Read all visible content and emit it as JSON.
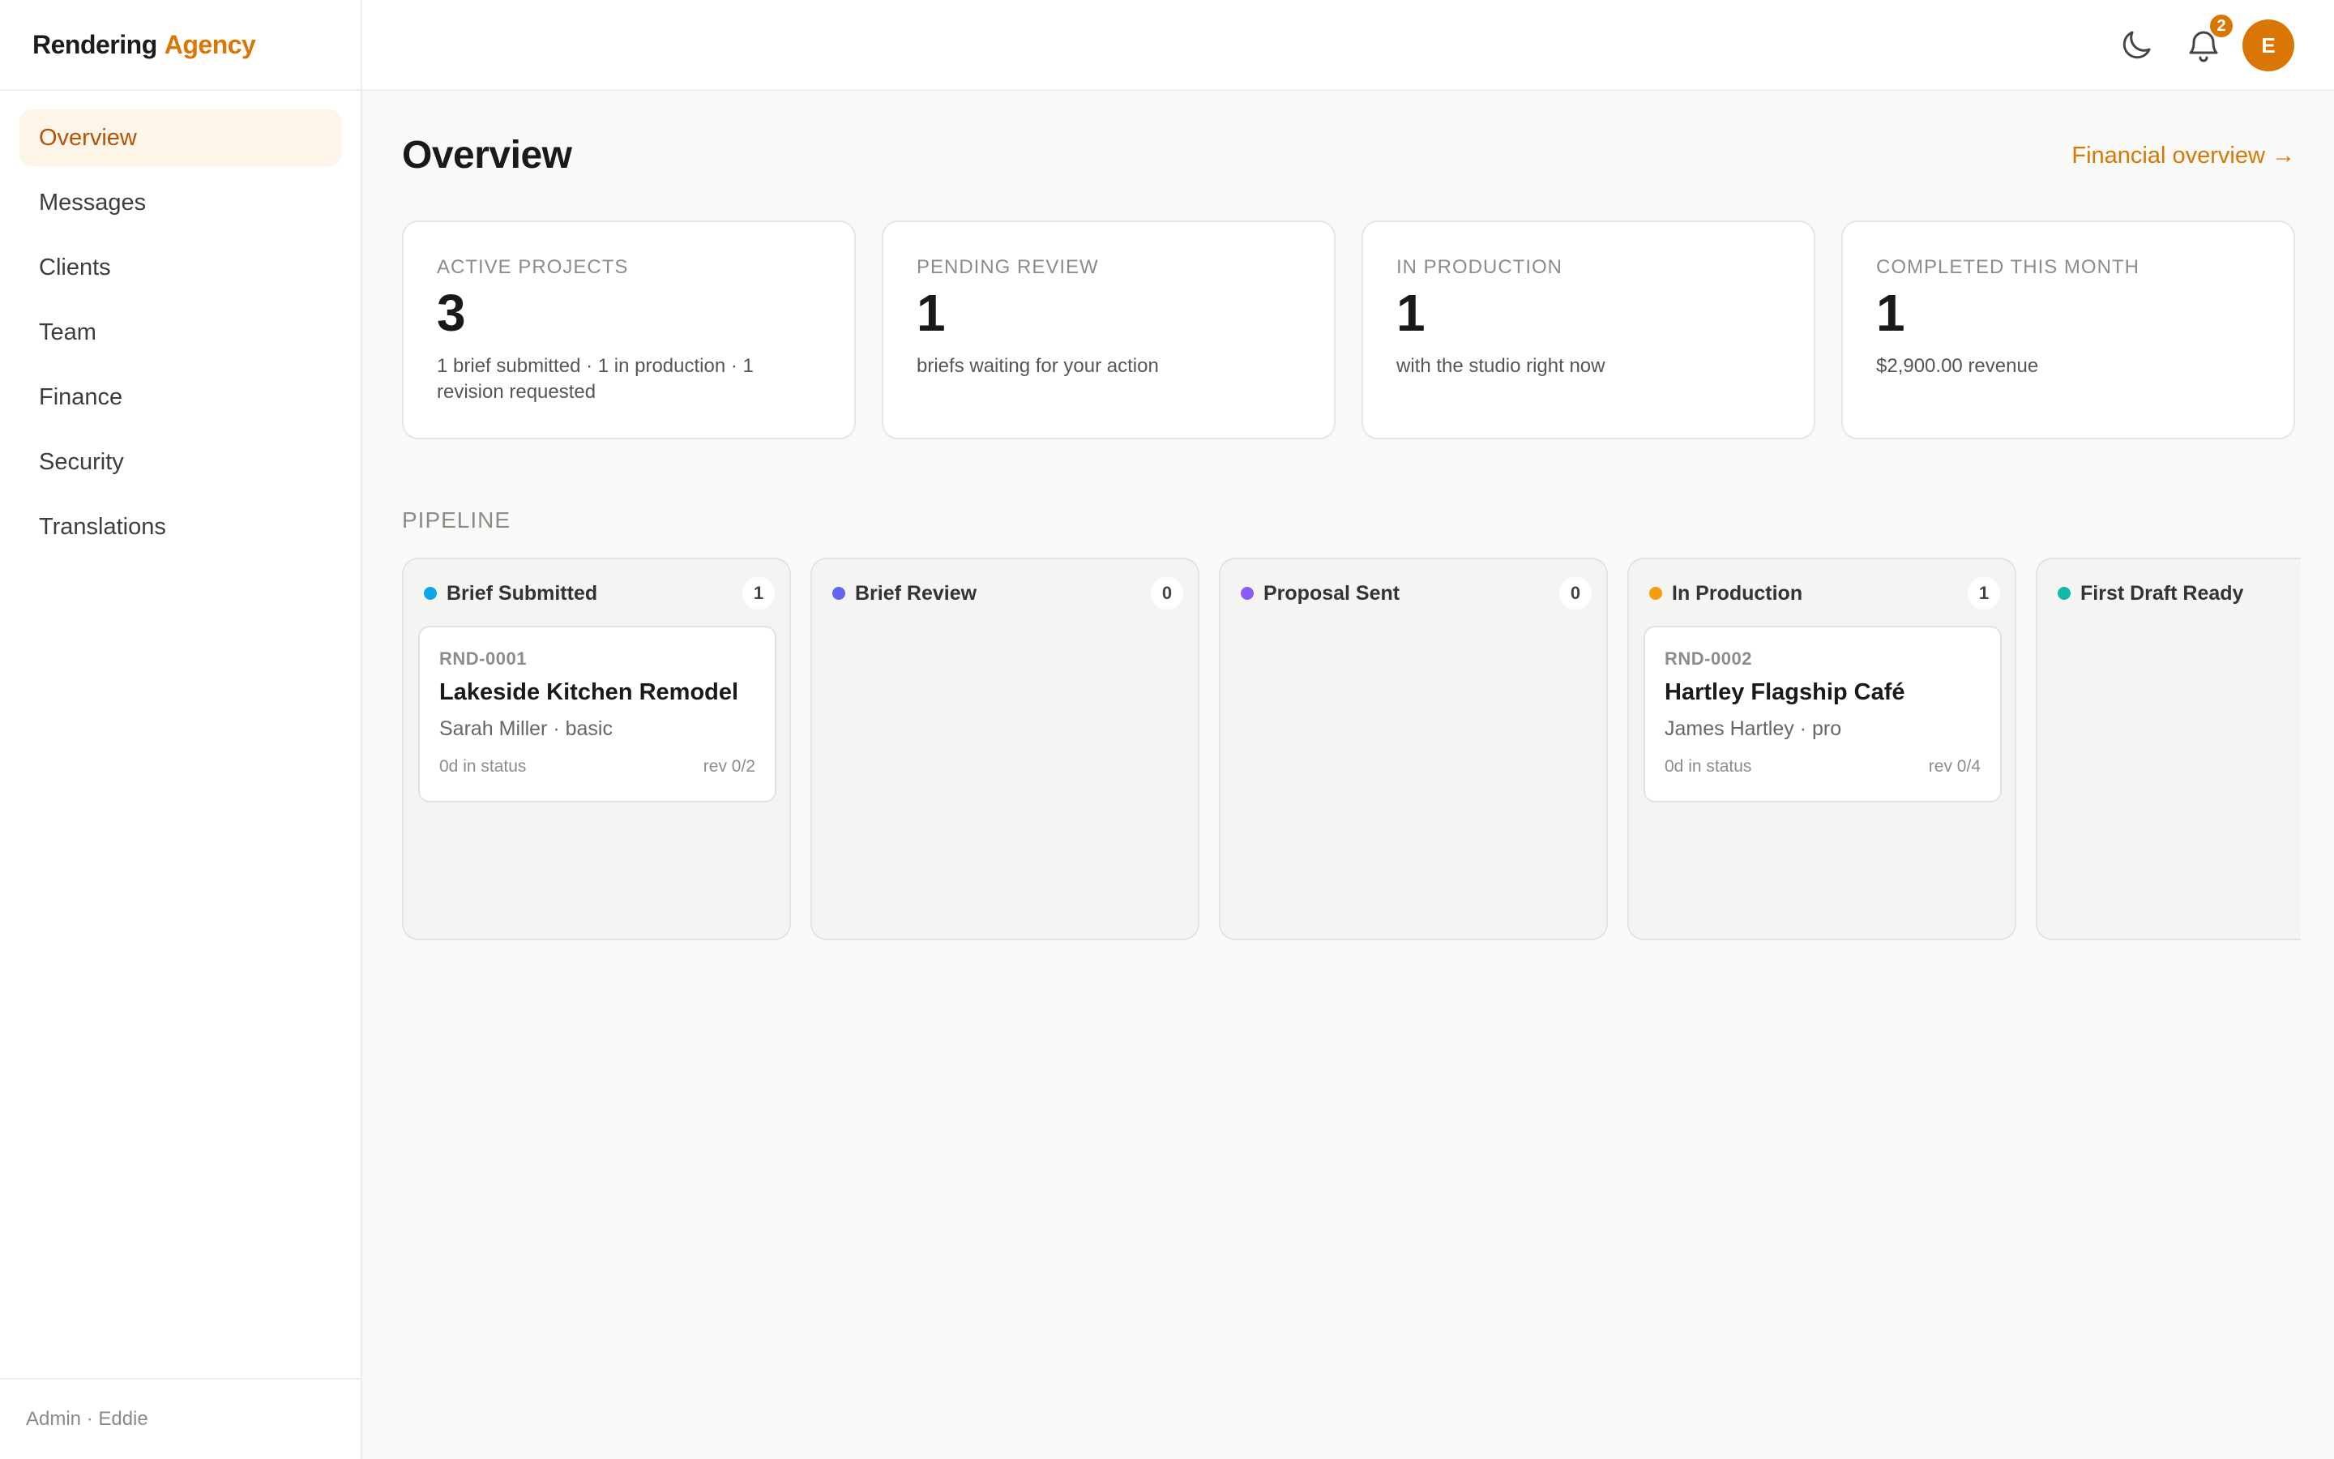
{
  "brand": {
    "name": "Rendering",
    "accent": "Agency"
  },
  "sidebar": {
    "items": [
      {
        "label": "Overview",
        "active": true
      },
      {
        "label": "Messages"
      },
      {
        "label": "Clients"
      },
      {
        "label": "Team"
      },
      {
        "label": "Finance"
      },
      {
        "label": "Security"
      },
      {
        "label": "Translations"
      }
    ],
    "footer": "Admin · Eddie"
  },
  "topbar": {
    "notification_count": "2",
    "avatar_initial": "E"
  },
  "page": {
    "title": "Overview",
    "financial_link": "Financial overview →"
  },
  "stats": [
    {
      "label": "ACTIVE PROJECTS",
      "value": "3",
      "sub": "1 brief submitted · 1 in production · 1 revision requested"
    },
    {
      "label": "PENDING REVIEW",
      "value": "1",
      "sub": "briefs waiting for your action"
    },
    {
      "label": "IN PRODUCTION",
      "value": "1",
      "sub": "with the studio right now"
    },
    {
      "label": "COMPLETED THIS MONTH",
      "value": "1",
      "sub": "$2,900.00 revenue"
    }
  ],
  "pipeline": {
    "label": "PIPELINE",
    "columns": [
      {
        "title": "Brief Submitted",
        "count": "1",
        "color": "#0ea5e9",
        "card": {
          "code": "RND-0001",
          "title": "Lakeside Kitchen Remodel",
          "meta": "Sarah Miller · basic",
          "status": "0d in status",
          "rev": "rev 0/2"
        }
      },
      {
        "title": "Brief Review",
        "count": "0",
        "color": "#6366f1"
      },
      {
        "title": "Proposal Sent",
        "count": "0",
        "color": "#8b5cf6"
      },
      {
        "title": "In Production",
        "count": "1",
        "color": "#f59e0b",
        "card": {
          "code": "RND-0002",
          "title": "Hartley Flagship Café",
          "meta": "James Hartley · pro",
          "status": "0d in status",
          "rev": "rev 0/4"
        }
      },
      {
        "title": "First Draft Ready",
        "color": "#14b8a6"
      }
    ]
  }
}
